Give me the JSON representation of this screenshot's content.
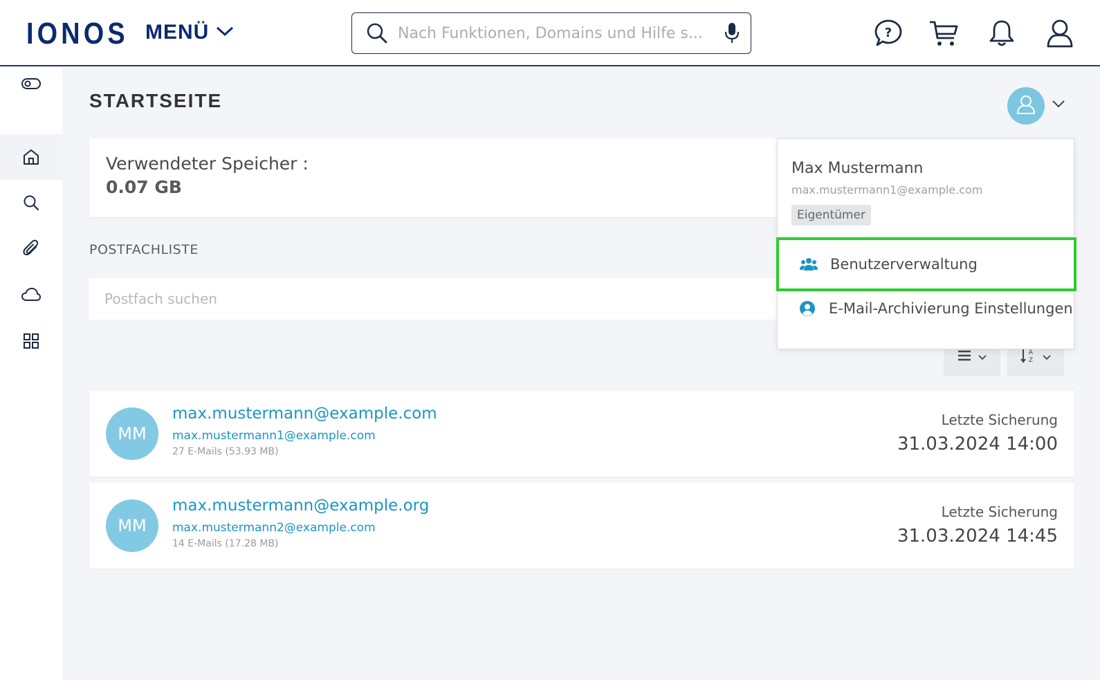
{
  "header": {
    "logo": "IONOS",
    "menu_label": "MENÜ",
    "search_placeholder": "Nach Funktionen, Domains und Hilfe s..."
  },
  "page": {
    "title": "STARTSEITE"
  },
  "storage": {
    "label": "Verwendeter Speicher :",
    "value": "0.07 GB"
  },
  "mailbox_list": {
    "title": "POSTFACHLISTE",
    "search_placeholder": "Postfach suchen",
    "items": [
      {
        "initials": "MM",
        "primary": "max.mustermann@example.com",
        "secondary": "max.mustermann1@example.com",
        "count": "27 E-Mails (53.93 MB)",
        "backup_label": "Letzte Sicherung",
        "backup_date": "31.03.2024 14:00"
      },
      {
        "initials": "MM",
        "primary": "max.mustermann@example.org",
        "secondary": "max.mustermann2@example.com",
        "count": "14 E-Mails (17.28 MB)",
        "backup_label": "Letzte Sicherung",
        "backup_date": "31.03.2024 14:45"
      }
    ]
  },
  "user_menu": {
    "name": "Max Mustermann",
    "email": "max.mustermann1@example.com",
    "role": "Eigentümer",
    "items": [
      {
        "label": "Benutzerverwaltung",
        "icon": "users-icon"
      },
      {
        "label": "E-Mail-Archivierung Einstellungen",
        "icon": "user-circle-icon"
      }
    ]
  },
  "colors": {
    "brand": "#0b2a6f",
    "accent": "#1a95c7",
    "avatar": "#82c9e4",
    "highlight": "#2ecc2e"
  }
}
